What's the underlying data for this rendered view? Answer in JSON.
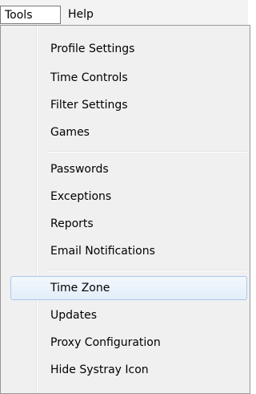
{
  "menubar": {
    "items": [
      {
        "label": "Tools"
      },
      {
        "label": "Help"
      }
    ]
  },
  "dropdown": {
    "groups": [
      [
        {
          "label": "Profile Settings"
        },
        {
          "label": "Time Controls"
        },
        {
          "label": "Filter Settings"
        },
        {
          "label": "Games"
        }
      ],
      [
        {
          "label": "Passwords"
        },
        {
          "label": "Exceptions"
        },
        {
          "label": "Reports"
        },
        {
          "label": "Email Notifications"
        }
      ],
      [
        {
          "label": "Time Zone",
          "highlighted": true
        },
        {
          "label": "Updates"
        },
        {
          "label": "Proxy Configuration"
        },
        {
          "label": "Hide Systray Icon"
        }
      ]
    ]
  }
}
